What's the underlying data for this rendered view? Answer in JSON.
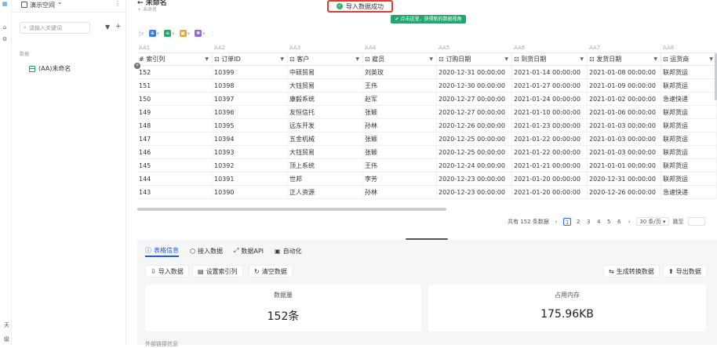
{
  "app": {
    "workspace": "演示空间",
    "search_placeholder": "请输入关键词",
    "section_label": "数据",
    "tree_item": "(AA)未命名",
    "rail_texts": [
      "天",
      "级"
    ]
  },
  "header": {
    "title": "未命名",
    "subtitle": "未命名"
  },
  "toast": {
    "text": "导入数据成功"
  },
  "tip": {
    "text": "点击这里，获得新的数据视角"
  },
  "column_letters": [
    "AA1",
    "AA2",
    "AA3",
    "AA4",
    "AA5",
    "AA6",
    "AA7",
    "AA8"
  ],
  "columns": [
    "索引列",
    "订单ID",
    "客户",
    "雇员",
    "订购日期",
    "到货日期",
    "发货日期",
    "运货商"
  ],
  "rows": [
    [
      "152",
      "10399",
      "中硕贸易",
      "刘英玫",
      "2020-12-31 00:00:00",
      "2021-01-14 00:00:00",
      "2021-01-08 00:00:00",
      "联邦货运"
    ],
    [
      "151",
      "10398",
      "大钰贸易",
      "王伟",
      "2020-12-30 00:00:00",
      "2021-01-27 00:00:00",
      "2021-01-09 00:00:00",
      "联邦货运"
    ],
    [
      "150",
      "10397",
      "康毅系统",
      "赵军",
      "2020-12-27 00:00:00",
      "2021-01-24 00:00:00",
      "2021-01-02 00:00:00",
      "急速快递"
    ],
    [
      "149",
      "10396",
      "友恒信托",
      "张颖",
      "2020-12-27 00:00:00",
      "2021-01-10 00:00:00",
      "2021-01-06 00:00:00",
      "联邦货运"
    ],
    [
      "148",
      "10395",
      "远东开发",
      "孙林",
      "2020-12-26 00:00:00",
      "2021-01-23 00:00:00",
      "2021-01-03 00:00:00",
      "联邦货运"
    ],
    [
      "147",
      "10394",
      "五金机械",
      "张颖",
      "2020-12-25 00:00:00",
      "2021-01-22 00:00:00",
      "2021-01-03 00:00:00",
      "联邦货运"
    ],
    [
      "146",
      "10393",
      "大钰贸易",
      "张颖",
      "2020-12-25 00:00:00",
      "2021-01-22 00:00:00",
      "2021-01-03 00:00:00",
      "联邦货运"
    ],
    [
      "145",
      "10392",
      "顶上系统",
      "王伟",
      "2020-12-24 00:00:00",
      "2021-01-21 00:00:00",
      "2021-01-01 00:00:00",
      "联邦货运"
    ],
    [
      "144",
      "10391",
      "世邦",
      "李芳",
      "2020-12-23 00:00:00",
      "2021-01-20 00:00:00",
      "2020-12-31 00:00:00",
      "联邦货运"
    ],
    [
      "143",
      "10390",
      "正人资源",
      "孙林",
      "2020-12-23 00:00:00",
      "2021-01-20 00:00:00",
      "2020-12-26 00:00:00",
      "急速快递"
    ]
  ],
  "pager": {
    "total": "共有 152 条数据",
    "pages": [
      "1",
      "2",
      "3",
      "4",
      "5",
      "6"
    ],
    "per_page": "30 条/页",
    "goto": "跳至"
  },
  "panel": {
    "tabs": [
      "表格信息",
      "接入数据",
      "数据API",
      "自动化"
    ],
    "buttons_left": [
      "导入数据",
      "设置索引列",
      "清空数据"
    ],
    "buttons_right": [
      "生成转换数据",
      "导出数据"
    ],
    "cards": [
      {
        "label": "数据量",
        "value": "152条"
      },
      {
        "label": "占用内存",
        "value": "175.96KB"
      }
    ],
    "more": "外部链接信息"
  },
  "colors": {
    "accent": "#1f5fd6",
    "success": "#20a870",
    "toast_border": "#e23b32"
  }
}
